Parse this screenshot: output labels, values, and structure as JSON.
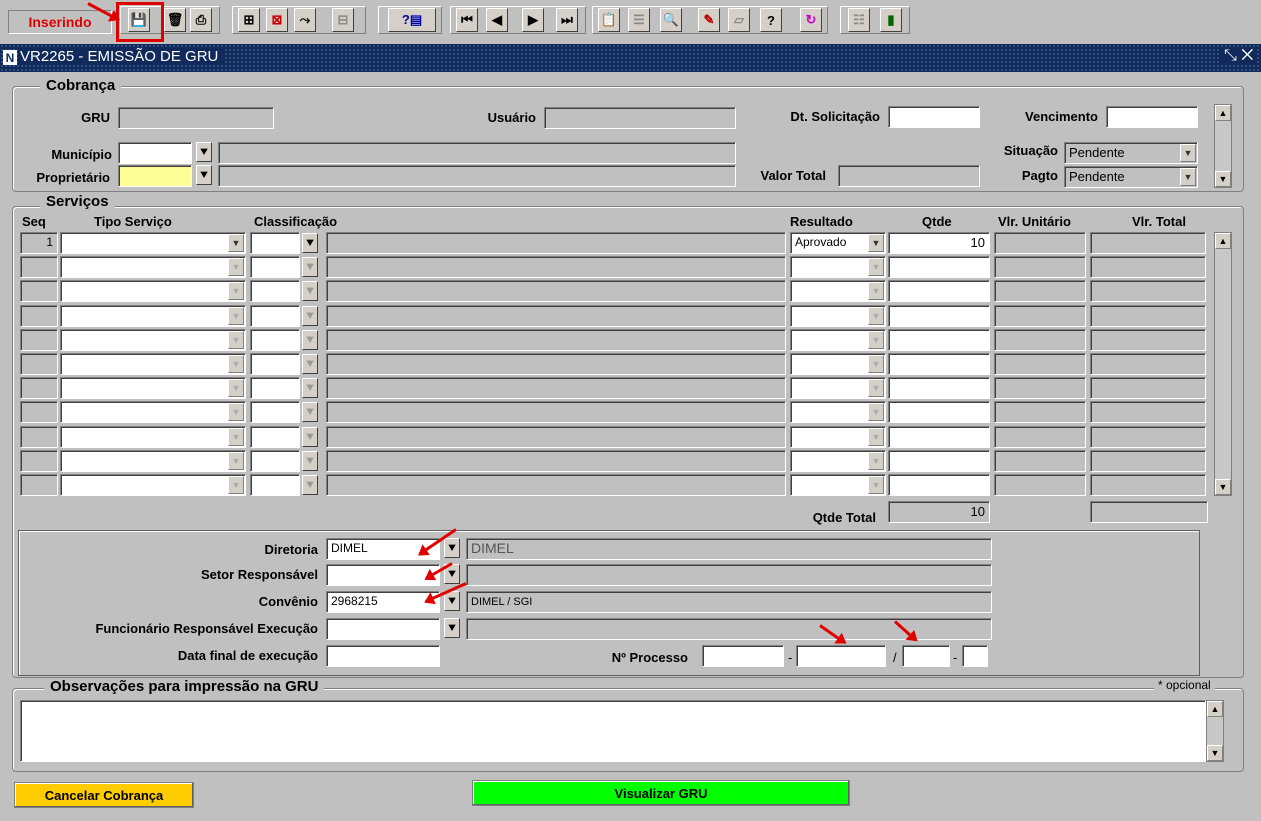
{
  "toolbar": {
    "mode": "Inserindo",
    "buttons": [
      "save-icon",
      "delete-icon",
      "print-icon",
      "insert-record-icon",
      "remove-record-icon",
      "duplicate-icon",
      "clear-icon",
      "query-icon",
      "first-icon",
      "previous-icon",
      "next-icon",
      "last-icon",
      "clipboard-icon",
      "list-icon",
      "search-icon",
      "edit-icon",
      "form-icon",
      "help-icon",
      "refresh-icon",
      "menu-icon",
      "exit-icon"
    ]
  },
  "window": {
    "title": "VR2265 - EMISSÃO DE GRU",
    "controls": "⤡ ✕"
  },
  "cobranca": {
    "section_title": "Cobrança",
    "gru_label": "GRU",
    "usuario_label": "Usuário",
    "dt_solicitacao_label": "Dt. Solicitação",
    "vencimento_label": "Vencimento",
    "municipio_label": "Município",
    "proprietario_label": "Proprietário",
    "valor_total_label": "Valor Total",
    "situacao_label": "Situação",
    "situacao_value": "Pendente",
    "pagto_label": "Pagto",
    "pagto_value": "Pendente"
  },
  "servicos": {
    "section_title": "Serviços",
    "columns": {
      "seq": "Seq",
      "tipo": "Tipo Serviço",
      "classificacao": "Classificação",
      "resultado": "Resultado",
      "qtde": "Qtde",
      "vlr_unitario": "Vlr. Unitário",
      "vlr_total": "Vlr. Total"
    },
    "rows": [
      {
        "seq": "1",
        "resultado": "Aprovado",
        "qtde": "10"
      },
      {
        "seq": "",
        "resultado": "",
        "qtde": ""
      },
      {
        "seq": "",
        "resultado": "",
        "qtde": ""
      },
      {
        "seq": "",
        "resultado": "",
        "qtde": ""
      },
      {
        "seq": "",
        "resultado": "",
        "qtde": ""
      },
      {
        "seq": "",
        "resultado": "",
        "qtde": ""
      },
      {
        "seq": "",
        "resultado": "",
        "qtde": ""
      },
      {
        "seq": "",
        "resultado": "",
        "qtde": ""
      },
      {
        "seq": "",
        "resultado": "",
        "qtde": ""
      },
      {
        "seq": "",
        "resultado": "",
        "qtde": ""
      },
      {
        "seq": "",
        "resultado": "",
        "qtde": ""
      }
    ],
    "qtde_total_label": "Qtde Total",
    "qtde_total_value": "10"
  },
  "execucao": {
    "diretoria_label": "Diretoria",
    "diretoria_code": "DIMEL",
    "diretoria_desc": "DIMEL",
    "setor_label": "Setor Responsável",
    "convenio_label": "Convênio",
    "convenio_code": "2968215",
    "convenio_desc": "DIMEL / SGI",
    "funcionario_label": "Funcionário Responsável Execução",
    "data_final_label": "Data final de execução",
    "processo_label": "Nº Processo",
    "sep1": "-",
    "sep2": "/",
    "sep3": "-"
  },
  "observacoes": {
    "section_title": "Observações para impressão na GRU",
    "optional_note": "* opcional"
  },
  "actions": {
    "cancel_label": "Cancelar Cobrança",
    "view_label": "Visualizar GRU"
  },
  "colors": {
    "title_bar": "#102a5c",
    "mode_text": "#e00000",
    "yellow_field": "#ffff99",
    "cancel_button": "#ffcc00",
    "view_button": "#00ff00",
    "annotation_arrow": "#e00000"
  }
}
